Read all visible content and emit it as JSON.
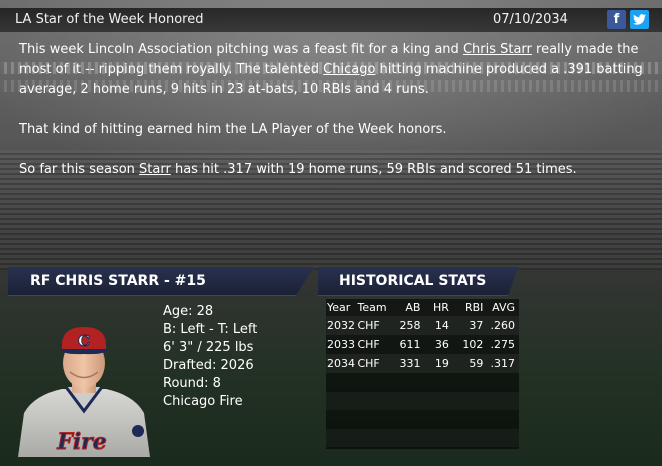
{
  "header": {
    "title": "LA Star of the Week Honored",
    "date": "07/10/2034",
    "facebook_glyph": "f"
  },
  "story": {
    "p1": {
      "t1": "This week Lincoln Association pitching was a feast fit for a king and ",
      "player_link": "Chris Starr",
      "t2": " really made the most of it -- ripping them royally. The talented ",
      "team_link": "Chicago",
      "t3": " hitting machine produced a .391 batting average, 2 home runs, 9 hits in 23 at-bats, 10 RBIs and 4 runs."
    },
    "p2": "That kind of hitting earned him the LA Player of the Week honors.",
    "p3": {
      "t1": "So far this season ",
      "player_link": "Starr",
      "t2": " has hit .317 with 19 home runs, 59 RBIs and scored 51 times."
    }
  },
  "player": {
    "banner": "RF CHRIS STARR - #15",
    "age": "Age: 28",
    "bats_throws": "B: Left - T: Left",
    "size": "6' 3\" / 225 lbs",
    "drafted": "Drafted: 2026",
    "round": "Round: 8",
    "team": "Chicago Fire",
    "cap_letter": "C",
    "jersey_text": "Fire"
  },
  "historical": {
    "banner": "HISTORICAL STATS",
    "headers": [
      "Year",
      "Team",
      "AB",
      "HR",
      "RBI",
      "AVG"
    ],
    "rows": [
      [
        "2032",
        "CHF",
        "258",
        "14",
        "37",
        ".260"
      ],
      [
        "2033",
        "CHF",
        "611",
        "36",
        "102",
        ".275"
      ],
      [
        "2034",
        "CHF",
        "331",
        "19",
        "59",
        ".317"
      ]
    ]
  },
  "colors": {
    "facebook": "#3b5998",
    "twitter": "#1da1f2",
    "banner": "#28314f",
    "cap": "#b22222"
  },
  "icons": [
    "facebook-icon",
    "twitter-icon"
  ]
}
